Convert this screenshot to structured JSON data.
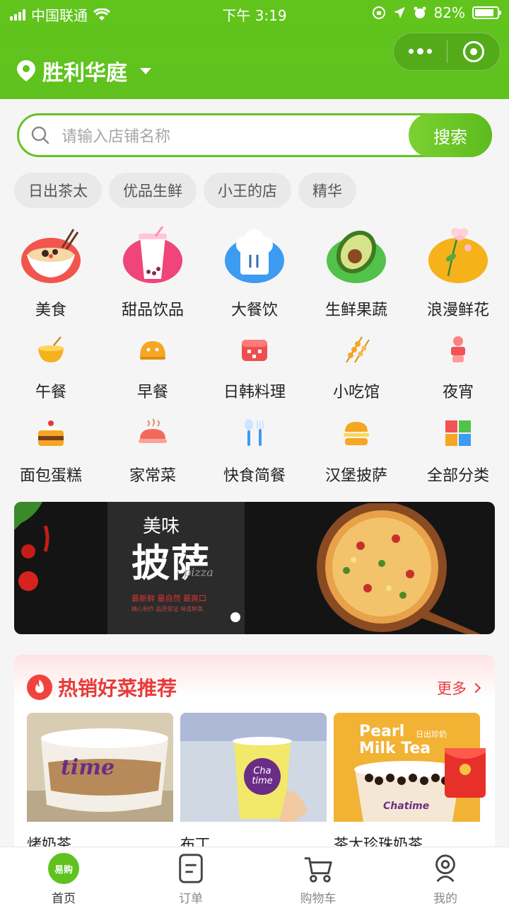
{
  "status": {
    "carrier": "中国联通",
    "time": "下午 3:19",
    "battery": "82%"
  },
  "header": {
    "location": "胜利华庭"
  },
  "search": {
    "placeholder": "请输入店铺名称",
    "button": "搜索"
  },
  "tags": [
    "日出茶太",
    "优品生鲜",
    "小王的店",
    "精华"
  ],
  "categories_big": [
    {
      "label": "美食",
      "icon": "noodle-bowl-icon",
      "color": "#f2554d"
    },
    {
      "label": "甜品饮品",
      "icon": "bubble-tea-icon",
      "color": "#f0457a"
    },
    {
      "label": "大餐饮",
      "icon": "chef-hat-icon",
      "color": "#3d9bf2"
    },
    {
      "label": "生鲜果蔬",
      "icon": "avocado-icon",
      "color": "#52c24a"
    },
    {
      "label": "浪漫鲜花",
      "icon": "flower-icon",
      "color": "#f5b21b"
    }
  ],
  "categories_row2": [
    {
      "label": "午餐",
      "icon": "lunch-bowl-icon"
    },
    {
      "label": "早餐",
      "icon": "bun-icon"
    },
    {
      "label": "日韩料理",
      "icon": "sushi-icon"
    },
    {
      "label": "小吃馆",
      "icon": "skewer-icon"
    },
    {
      "label": "夜宵",
      "icon": "lantern-icon"
    }
  ],
  "categories_row3": [
    {
      "label": "面包蛋糕",
      "icon": "cake-icon"
    },
    {
      "label": "家常菜",
      "icon": "hot-dish-icon"
    },
    {
      "label": "快食简餐",
      "icon": "cutlery-icon"
    },
    {
      "label": "汉堡披萨",
      "icon": "burger-icon"
    },
    {
      "label": "全部分类",
      "icon": "grid-icon"
    }
  ],
  "banner": {
    "line1": "美味",
    "line2": "披萨",
    "line3": "pizza",
    "line4": "最新鲜 最自然 最爽口",
    "line5": "精心制作 品质保证 味道鲜美"
  },
  "hot": {
    "title": "热销好菜推荐",
    "more": "更多",
    "items": [
      {
        "name": "烤奶茶"
      },
      {
        "name": "布丁"
      },
      {
        "name": "茶太珍珠奶茶"
      }
    ],
    "card3_text1": "Pearl",
    "card3_text2": "日出珍奶",
    "card3_text3": "Milk Tea",
    "card3_brand": "Chatime",
    "card2_brand": "Cha time",
    "card1_brand": "time"
  },
  "tabbar": {
    "home_badge": "易购",
    "items": [
      {
        "label": "首页"
      },
      {
        "label": "订单"
      },
      {
        "label": "购物车"
      },
      {
        "label": "我的"
      }
    ]
  }
}
